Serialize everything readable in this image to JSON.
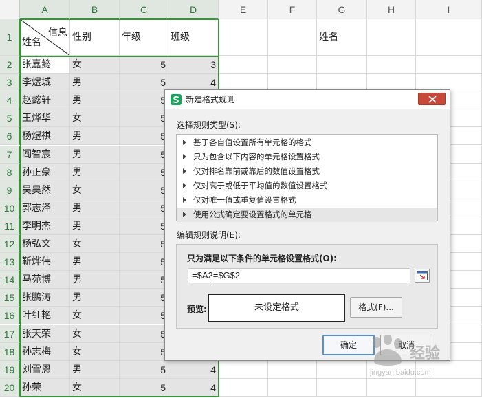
{
  "sheet": {
    "columns": [
      "A",
      "B",
      "C",
      "D",
      "E",
      "F",
      "G",
      "H",
      "I"
    ],
    "row_numbers": [
      "1",
      "2",
      "3",
      "4",
      "5",
      "6",
      "7",
      "8",
      "9",
      "10",
      "11",
      "12",
      "13",
      "14",
      "15",
      "16",
      "17",
      "18",
      "19",
      "20"
    ],
    "header_row": {
      "a1_top": "信息",
      "a1_bottom": "姓名",
      "b1": "性别",
      "c1": "年级",
      "d1": "班级",
      "g1": "姓名"
    },
    "rows": [
      {
        "name": "张嘉懿",
        "gender": "女",
        "grade": "5",
        "class": "3"
      },
      {
        "name": "李煜城",
        "gender": "男",
        "grade": "5",
        "class": "4"
      },
      {
        "name": "赵懿轩",
        "gender": "男",
        "grade": "5",
        "class": ""
      },
      {
        "name": "王烨华",
        "gender": "女",
        "grade": "5",
        "class": ""
      },
      {
        "name": "杨煜祺",
        "gender": "男",
        "grade": "5",
        "class": ""
      },
      {
        "name": "阎智宸",
        "gender": "男",
        "grade": "5",
        "class": ""
      },
      {
        "name": "孙正豪",
        "gender": "男",
        "grade": "5",
        "class": ""
      },
      {
        "name": "吴昊然",
        "gender": "女",
        "grade": "5",
        "class": ""
      },
      {
        "name": "郭志泽",
        "gender": "男",
        "grade": "5",
        "class": ""
      },
      {
        "name": "李明杰",
        "gender": "男",
        "grade": "5",
        "class": ""
      },
      {
        "name": "杨弘文",
        "gender": "女",
        "grade": "5",
        "class": ""
      },
      {
        "name": "靳烨伟",
        "gender": "男",
        "grade": "5",
        "class": ""
      },
      {
        "name": "马苑博",
        "gender": "男",
        "grade": "5",
        "class": ""
      },
      {
        "name": "张鹏涛",
        "gender": "男",
        "grade": "5",
        "class": ""
      },
      {
        "name": "叶红艳",
        "gender": "女",
        "grade": "5",
        "class": ""
      },
      {
        "name": "张天荣",
        "gender": "女",
        "grade": "5",
        "class": ""
      },
      {
        "name": "孙志梅",
        "gender": "女",
        "grade": "5",
        "class": ""
      },
      {
        "name": "刘雪恩",
        "gender": "男",
        "grade": "5",
        "class": "4"
      },
      {
        "name": "孙荣",
        "gender": "女",
        "grade": "5",
        "class": "4"
      }
    ]
  },
  "dialog": {
    "title": "新建格式规则",
    "icon": "wps-s-icon",
    "close_icon": "close-icon",
    "rule_type_label": "选择规则类型(S):",
    "rule_types": [
      "基于各自值设置所有单元格的格式",
      "只为包含以下内容的单元格设置格式",
      "仅对排名靠前或靠后的数值设置格式",
      "仅对高于或低于平均值的数值设置格式",
      "仅对唯一值或重复值设置格式",
      "使用公式确定要设置格式的单元格"
    ],
    "selected_rule_index": 5,
    "edit_label": "编辑规则说明(E):",
    "formula_label": "只为满足以下条件的单元格设置格式(O):",
    "formula_value": "=$A2=$G$2",
    "preview_label": "预览:",
    "preview_text": "未设定格式",
    "format_button": "格式(F)...",
    "ok_button": "确定",
    "cancel_button": "取消"
  },
  "watermark": {
    "text": "经验",
    "sub": "jingyan.baidu.com"
  }
}
